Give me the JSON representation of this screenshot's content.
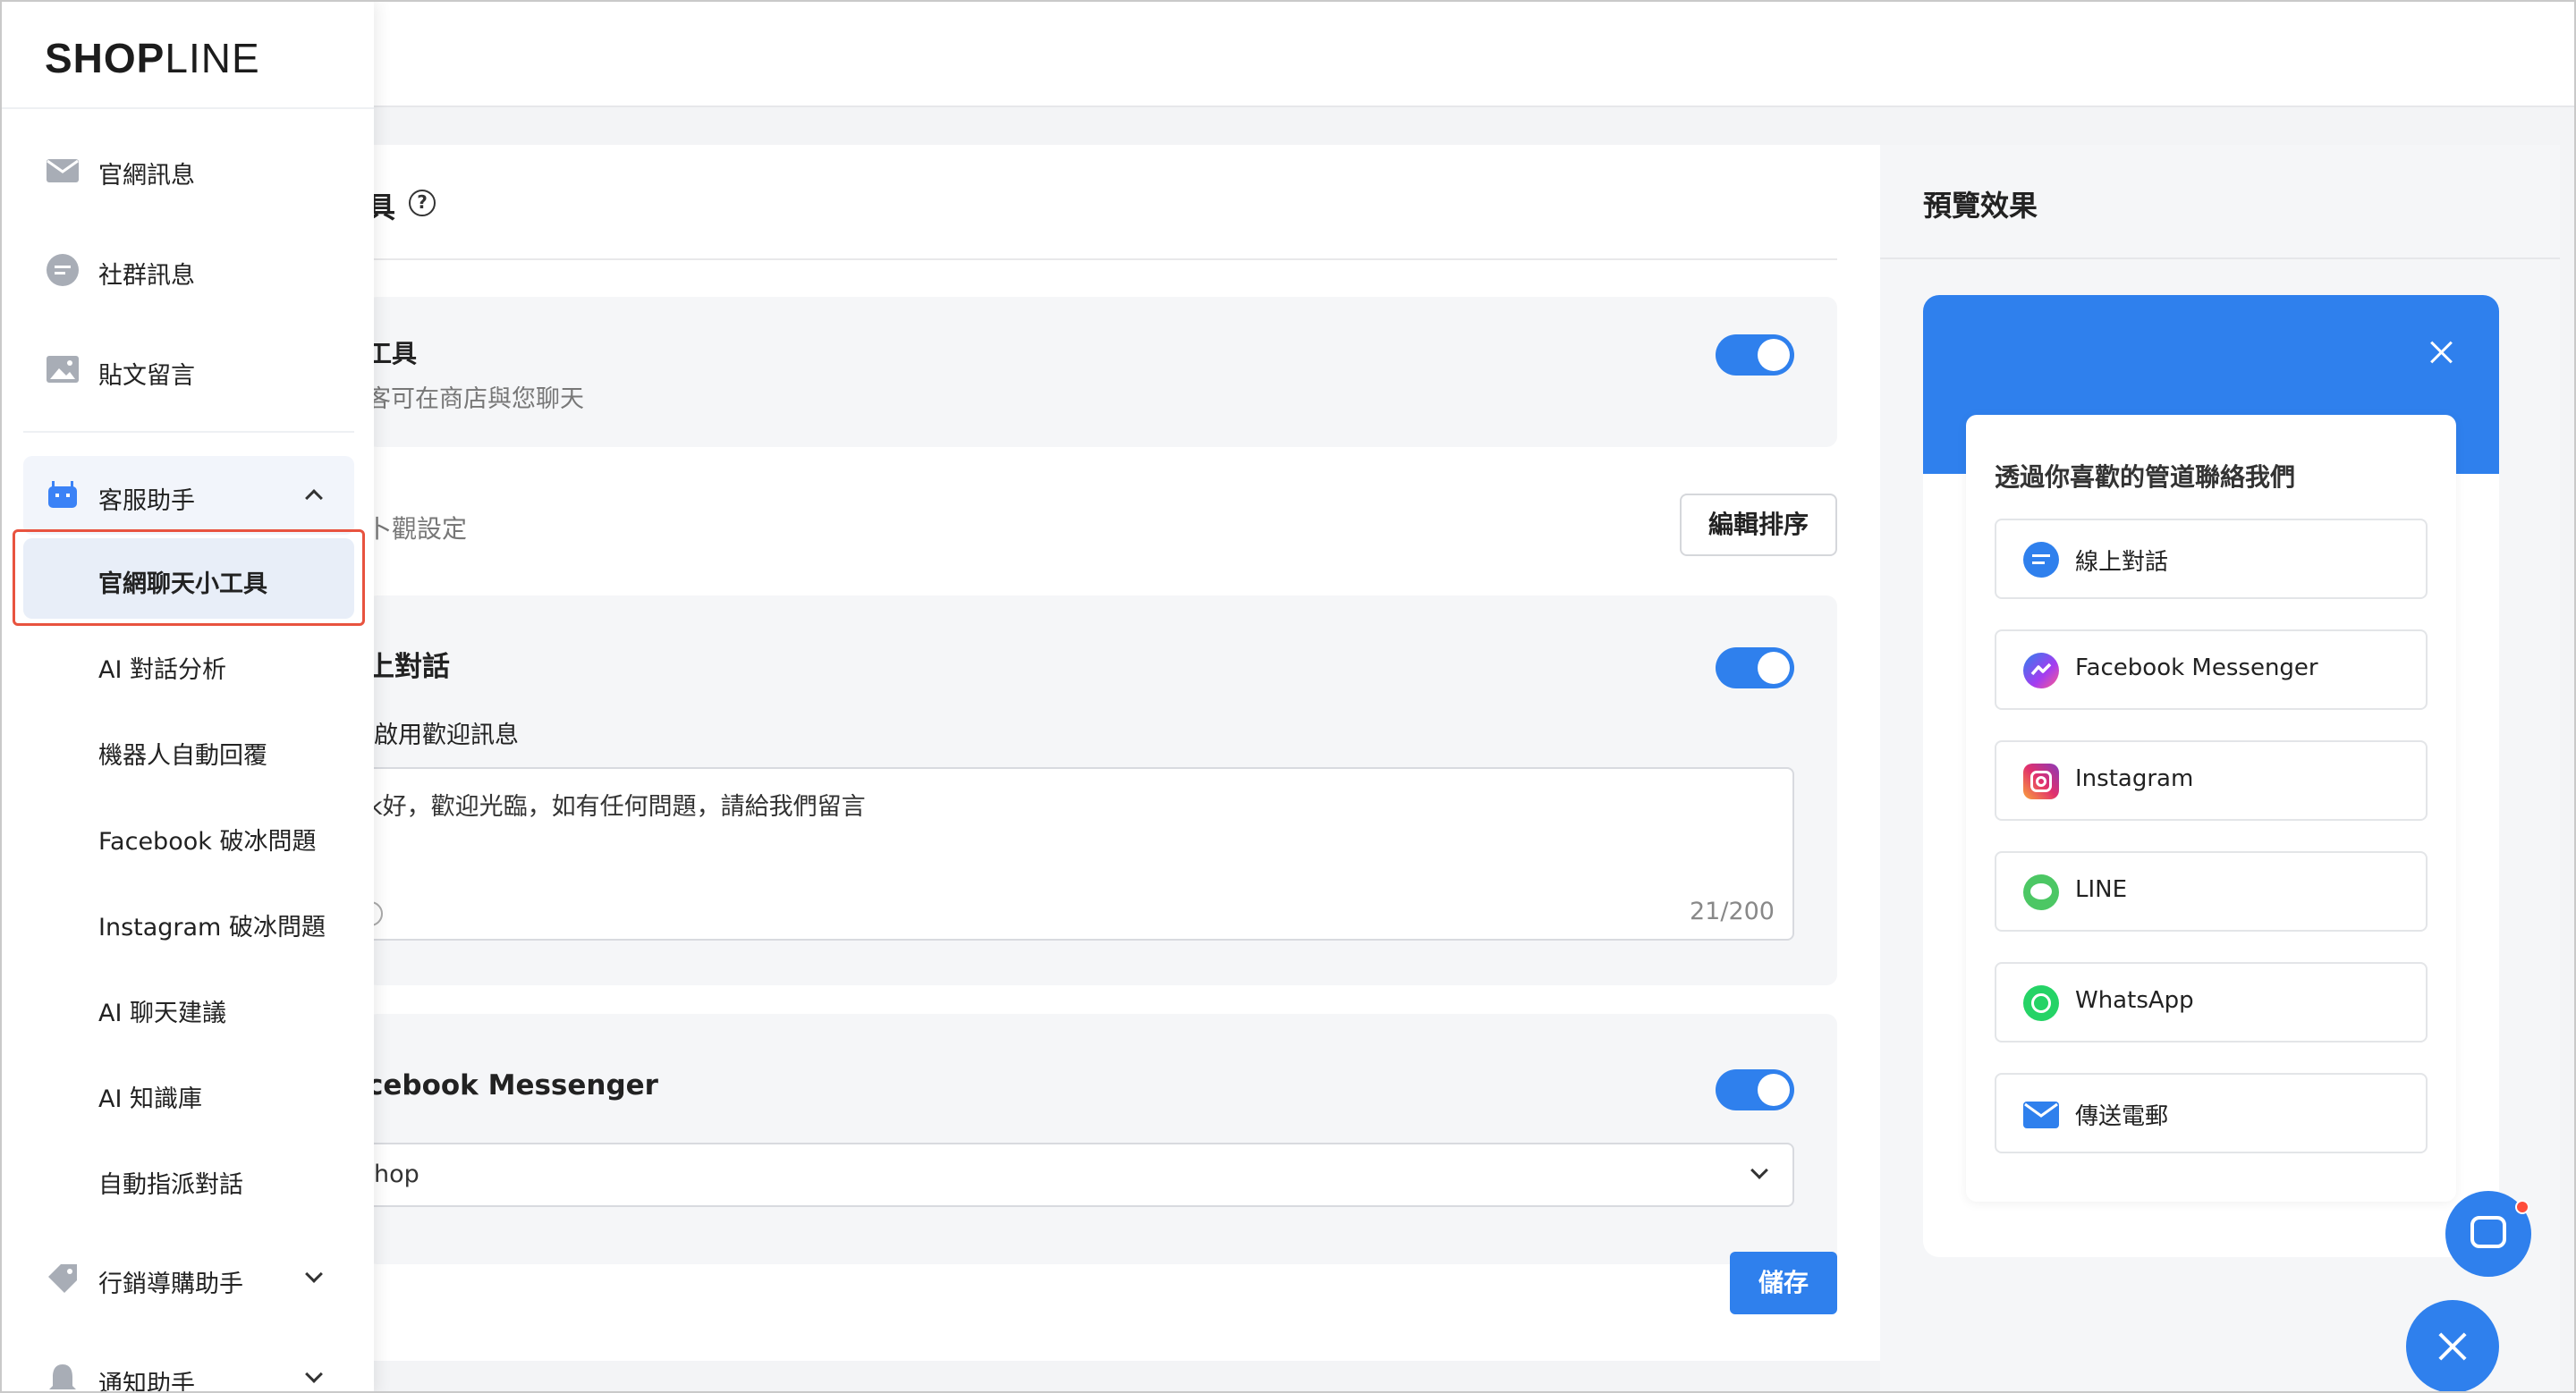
{
  "brand": {
    "name_bold": "SHOP",
    "name_light": "LINE"
  },
  "sidebar": {
    "items": [
      {
        "label": "官網訊息",
        "icon": "mail-icon"
      },
      {
        "label": "社群訊息",
        "icon": "chat-bubble-icon"
      },
      {
        "label": "貼文留言",
        "icon": "image-post-icon"
      }
    ],
    "group": {
      "label": "客服助手",
      "icon": "robot-icon",
      "expanded": true
    },
    "sub_items": [
      {
        "label": "官網聊天小工具",
        "active": true
      },
      {
        "label": "AI 對話分析"
      },
      {
        "label": "機器人自動回覆"
      },
      {
        "label": "Facebook 破冰問題"
      },
      {
        "label": "Instagram 破冰問題"
      },
      {
        "label": "AI 聊天建議"
      },
      {
        "label": "AI 知識庫"
      },
      {
        "label": "自動指派對話"
      }
    ],
    "bottom_items": [
      {
        "label": "行銷導購助手",
        "icon": "tag-icon"
      },
      {
        "label": "通知助手",
        "icon": "bell-icon"
      }
    ]
  },
  "main": {
    "title": "具",
    "help": "?",
    "tool_title": "工具",
    "tool_desc": "客可在商店與您聊天",
    "appearance_label": "卜觀設定",
    "edit_order_button": "編輯排序",
    "live_chat": {
      "title": "上對話",
      "welcome_label": "啟用歡迎訊息",
      "welcome_text": "k好，歡迎光臨，如有任何問題，請給我們留言",
      "char_count": "21/200"
    },
    "messenger": {
      "title": "cebook Messenger",
      "selected_page": "hop"
    },
    "save_button": "儲存"
  },
  "preview": {
    "title": "預覽效果",
    "widget_heading": "透過你喜歡的管道聯絡我們",
    "channels": [
      {
        "label": "線上對話",
        "icon": "live-chat-icon",
        "color": "#2f80ed"
      },
      {
        "label": "Facebook Messenger",
        "icon": "messenger-icon",
        "color": "#7b5cf5"
      },
      {
        "label": "Instagram",
        "icon": "instagram-icon",
        "color": "#e1306c"
      },
      {
        "label": "LINE",
        "icon": "line-icon",
        "color": "#4cc764"
      },
      {
        "label": "WhatsApp",
        "icon": "whatsapp-icon",
        "color": "#25d366"
      },
      {
        "label": "傳送電郵",
        "icon": "email-icon",
        "color": "#2f80ed"
      }
    ]
  },
  "colors": {
    "accent": "#2f80ed",
    "highlight_border": "#e8533f",
    "active_bg": "#e8eef8"
  }
}
